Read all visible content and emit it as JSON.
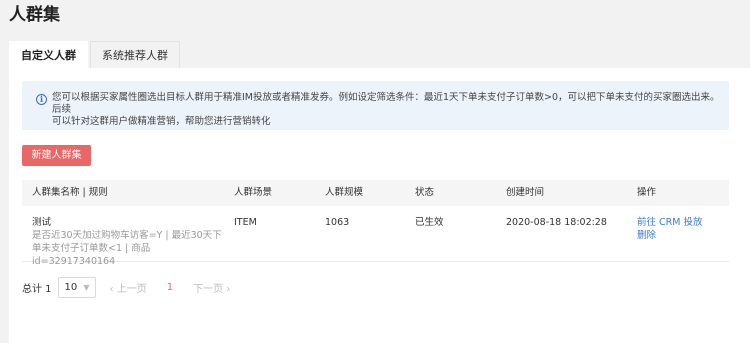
{
  "page": {
    "title": "人群集"
  },
  "tabs": [
    {
      "label": "自定义人群",
      "active": true
    },
    {
      "label": "系统推荐人群",
      "active": false
    }
  ],
  "notice": {
    "icon": "info-icon",
    "line1": "您可以根据买家属性圈选出目标人群用于精准IM投放或者精准发券。例如设定筛选条件：最近1天下单未支付子订单数>0，可以把下单未支付的买家圈选出来。后续",
    "line2": "可以针对这群用户做精准营销，帮助您进行营销转化"
  },
  "create_button": {
    "label": "新建人群集"
  },
  "table": {
    "headers": [
      "人群集名称 | 规则",
      "人群场景",
      "人群规模",
      "状态",
      "创建时间",
      "操作"
    ],
    "rows": [
      {
        "name": "测试",
        "rule_line1": "是否近30天加过购物车访客=Y | 最近30天下",
        "rule_line2": "单未支付子订单数<1 | 商品id=32917340164",
        "scene": "ITEM",
        "size": "1063",
        "status": "已生效",
        "created": "2020-08-18 18:02:28",
        "action_goto": "前往 CRM 投放",
        "action_delete": "删除"
      }
    ]
  },
  "pagination": {
    "total_label": "总计 1",
    "page_size": "10",
    "prev_label": "上一页",
    "current_page": "1",
    "next_label": "下一页"
  },
  "colors": {
    "primary_button": "#e96767",
    "link": "#3a7bd5",
    "notice_bg": "#edf3fb"
  }
}
